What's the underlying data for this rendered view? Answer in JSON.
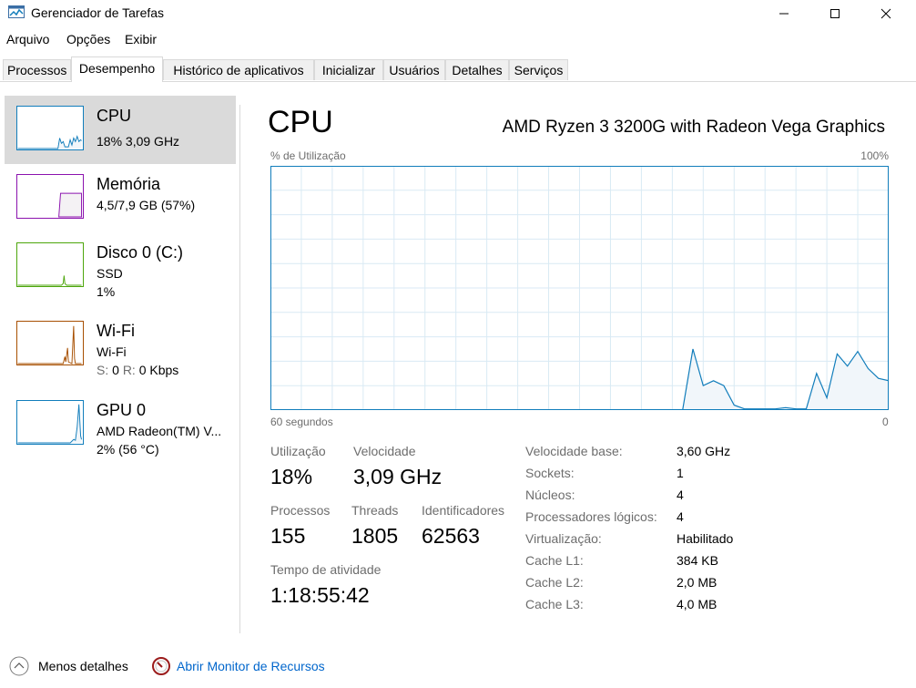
{
  "window": {
    "title": "Gerenciador de Tarefas"
  },
  "menu": [
    "Arquivo",
    "Opções",
    "Exibir"
  ],
  "tabs": [
    "Processos",
    "Desempenho",
    "Histórico de aplicativos",
    "Inicializar",
    "Usuários",
    "Detalhes",
    "Serviços"
  ],
  "active_tab": "Desempenho",
  "sidebar": {
    "items": [
      {
        "title": "CPU",
        "line1": "18% 3,09 GHz",
        "color": "#117dbb"
      },
      {
        "title": "Memória",
        "line1": "4,5/7,9 GB (57%)",
        "color": "#8b12ae"
      },
      {
        "title": "Disco 0 (C:)",
        "line1": "SSD",
        "line2": "1%",
        "color": "#4da60c"
      },
      {
        "title": "Wi-Fi",
        "line1": "Wi-Fi",
        "line2_parts": {
          "s_label": "S:",
          "s_value": "0",
          "r_label": "R:",
          "r_value": "0 Kbps"
        },
        "color": "#a74f01"
      },
      {
        "title": "GPU 0",
        "line1": "AMD Radeon(TM) V...",
        "line2": "2% (56 °C)",
        "color": "#117dbb"
      }
    ]
  },
  "main": {
    "title": "CPU",
    "model": "AMD Ryzen 3 3200G with Radeon Vega Graphics",
    "graph": {
      "label_left": "% de Utilização",
      "label_right": "100%",
      "axis_left": "60 segundos",
      "axis_right": "0",
      "line_color": "#117dbb",
      "fill_color": "#f1f6fa",
      "grid_color": "#d9eaf4"
    },
    "stats": {
      "util_label": "Utilização",
      "util_value": "18%",
      "speed_label": "Velocidade",
      "speed_value": "3,09 GHz",
      "proc_label": "Processos",
      "proc_value": "155",
      "threads_label": "Threads",
      "threads_value": "1805",
      "handles_label": "Identificadores",
      "handles_value": "62563",
      "uptime_label": "Tempo de atividade",
      "uptime_value": "1:18:55:42"
    },
    "specs": [
      {
        "label": "Velocidade base:",
        "value": "3,60 GHz"
      },
      {
        "label": "Sockets:",
        "value": "1"
      },
      {
        "label": "Núcleos:",
        "value": "4"
      },
      {
        "label": "Processadores lógicos:",
        "value": "4"
      },
      {
        "label": "Virtualização:",
        "value": "Habilitado"
      },
      {
        "label": "Cache L1:",
        "value": "384 KB"
      },
      {
        "label": "Cache L2:",
        "value": "2,0 MB"
      },
      {
        "label": "Cache L3:",
        "value": "4,0 MB"
      }
    ]
  },
  "footer": {
    "less_details": "Menos detalhes",
    "resource_monitor": "Abrir Monitor de Recursos"
  },
  "chart_data": {
    "type": "area",
    "title": "",
    "x": [
      0,
      3,
      6,
      9,
      12,
      15,
      18,
      21,
      24,
      27,
      30,
      33,
      36,
      39,
      40,
      41,
      42,
      43,
      44,
      45,
      46,
      47,
      48,
      49,
      50,
      51,
      52,
      53,
      54,
      55,
      56,
      57,
      58,
      59,
      60
    ],
    "y": [
      0,
      0,
      0,
      0,
      0,
      0,
      0,
      0,
      0,
      0,
      0,
      0,
      0,
      0,
      0,
      25,
      10,
      12,
      10,
      2,
      0.5,
      0.5,
      0.5,
      0.5,
      1,
      0.5,
      0.5,
      15,
      5,
      23,
      18,
      24,
      17,
      13,
      12,
      18
    ],
    "xlim": [
      0,
      60
    ],
    "ylim": [
      0,
      100
    ],
    "grid": true
  }
}
